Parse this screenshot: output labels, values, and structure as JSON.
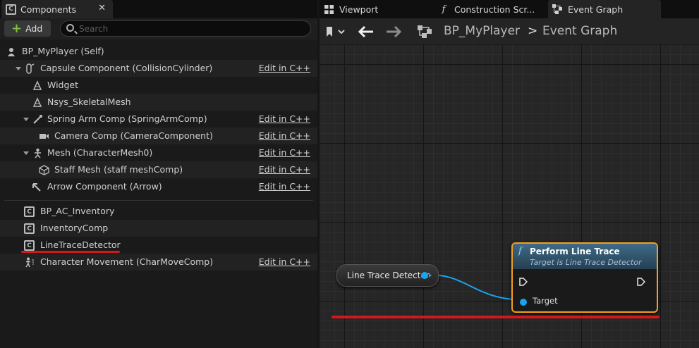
{
  "left_panel": {
    "tab_label": "Components",
    "add_label": "Add",
    "search_placeholder": "Search",
    "rows": [
      {
        "label": "BP_MyPlayer (Self)",
        "cpp": ""
      },
      {
        "label": "Capsule Component (CollisionCylinder)",
        "cpp": "Edit in C++"
      },
      {
        "label": "Widget",
        "cpp": ""
      },
      {
        "label": "Nsys_SkeletalMesh",
        "cpp": ""
      },
      {
        "label": "Spring Arm Comp (SpringArmComp)",
        "cpp": "Edit in C++"
      },
      {
        "label": "Camera Comp (CameraComponent)",
        "cpp": "Edit in C++"
      },
      {
        "label": "Mesh (CharacterMesh0)",
        "cpp": "Edit in C++"
      },
      {
        "label": "Staff Mesh (staff meshComp)",
        "cpp": "Edit in C++"
      },
      {
        "label": "Arrow Component (Arrow)",
        "cpp": "Edit in C++"
      },
      {
        "label": "BP_AC_Inventory",
        "cpp": ""
      },
      {
        "label": "InventoryComp",
        "cpp": ""
      },
      {
        "label": "LineTraceDetector",
        "cpp": ""
      },
      {
        "label": "Character Movement (CharMoveComp)",
        "cpp": "Edit in C++"
      }
    ]
  },
  "right_panel": {
    "tabs": [
      {
        "label": "Viewport",
        "icon": "viewport-icon"
      },
      {
        "label": "Construction Scr...",
        "icon": "function-icon"
      },
      {
        "label": "Event Graph",
        "icon": "event-graph-icon"
      }
    ],
    "breadcrumb": {
      "blueprint": "BP_MyPlayer",
      "separator": ">",
      "graph": "Event Graph"
    },
    "variable_node": {
      "label": "Line Trace Detector"
    },
    "function_node": {
      "icon": "f",
      "title": "Perform Line Trace",
      "subtitle": "Target is Line Trace Detector",
      "target_label": "Target"
    }
  },
  "colors": {
    "accent_red": "#d4161d",
    "pin_blue": "#1aa3f0",
    "node_border_orange": "#f2a020",
    "add_plus_green": "#7dc43a"
  }
}
